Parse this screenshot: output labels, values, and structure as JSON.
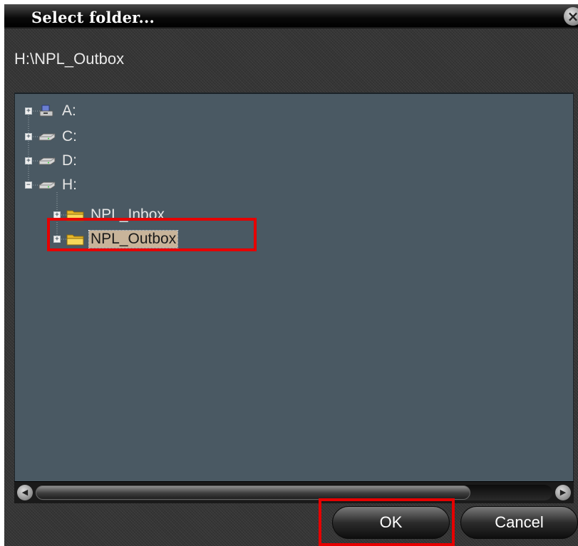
{
  "dialog": {
    "title": "Select folder...",
    "close_glyph": "×",
    "current_path": "H:\\NPL_Outbox"
  },
  "tree": {
    "items": [
      {
        "label": "A:",
        "icon": "floppy-drive-icon",
        "expander": "+"
      },
      {
        "label": "C:",
        "icon": "hard-drive-icon",
        "expander": "+"
      },
      {
        "label": "D:",
        "icon": "hard-drive-icon",
        "expander": "+"
      },
      {
        "label": "H:",
        "icon": "hard-drive-icon",
        "expander": "−"
      },
      {
        "label": "NPL_Inbox",
        "icon": "folder-icon",
        "expander": "+"
      },
      {
        "label": "NPL_Outbox",
        "icon": "folder-icon",
        "expander": "+",
        "selected": true
      }
    ]
  },
  "scrollbar": {
    "left_arrow": "◀",
    "right_arrow": "▶",
    "position": 0
  },
  "buttons": {
    "ok_label": "OK",
    "cancel_label": "Cancel"
  },
  "colors": {
    "highlight": "#e60000",
    "tree_background": "#4a5963",
    "selection": "#c8b49a"
  }
}
